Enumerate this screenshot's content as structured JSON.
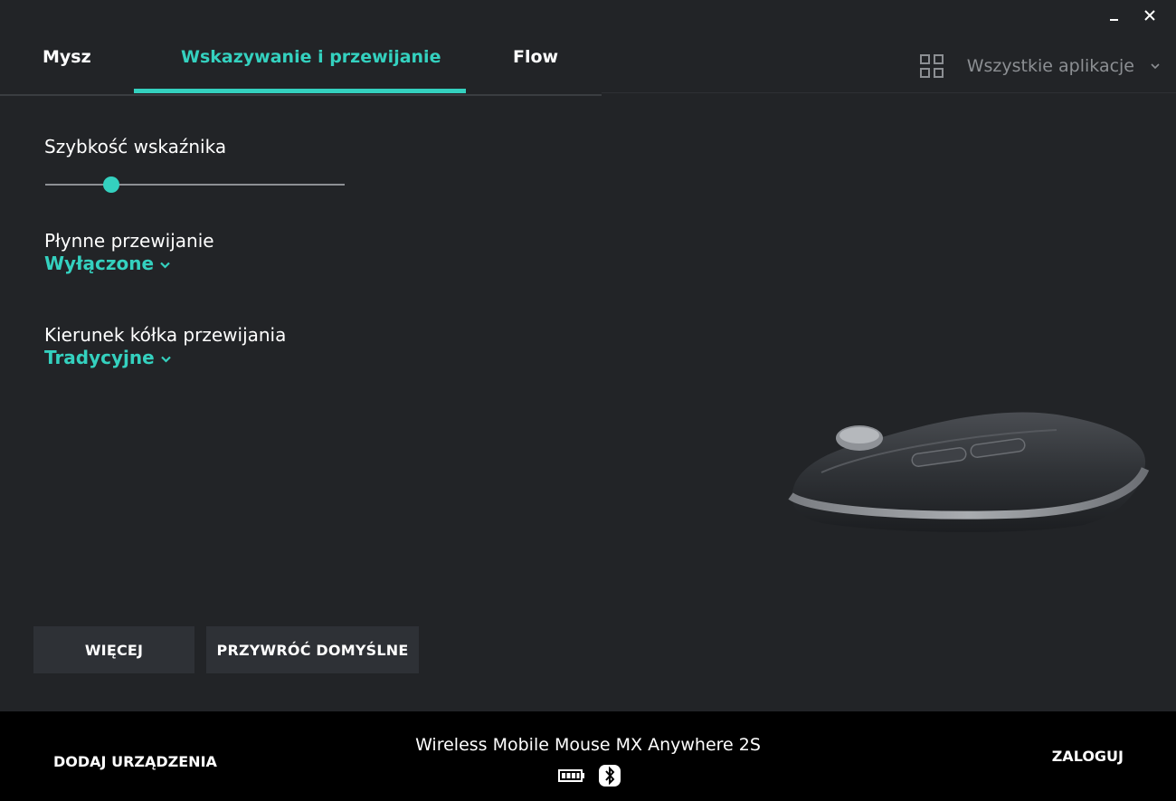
{
  "window": {
    "minimize_icon": "minimize-icon",
    "close_icon": "close-icon"
  },
  "tabs": [
    {
      "label": "Mysz",
      "active": false
    },
    {
      "label": "Wskazywanie i przewijanie",
      "active": true
    },
    {
      "label": "Flow",
      "active": false
    }
  ],
  "app_filter": {
    "label": "Wszystkie aplikacje",
    "icon": "grid-icon"
  },
  "settings": {
    "pointer_speed": {
      "label": "Szybkość wskaźnika",
      "value": 0.22
    },
    "smooth_scrolling": {
      "label": "Płynne przewijanie",
      "value": "Wyłączone"
    },
    "scroll_direction": {
      "label": "Kierunek kółka przewijania",
      "value": "Tradycyjne"
    }
  },
  "buttons": {
    "more": "WIĘCEJ",
    "restore_defaults": "PRZYWRÓĆ DOMYŚLNE"
  },
  "footer": {
    "add_devices": "DODAJ URZĄDZENIA",
    "device_name": "Wireless Mobile Mouse MX Anywhere 2S",
    "login": "ZALOGUJ",
    "status_icons": [
      "battery-icon",
      "bluetooth-icon"
    ]
  },
  "colors": {
    "accent": "#34d1bf",
    "background": "#222427",
    "footer": "#000000",
    "button": "#2e3136"
  }
}
